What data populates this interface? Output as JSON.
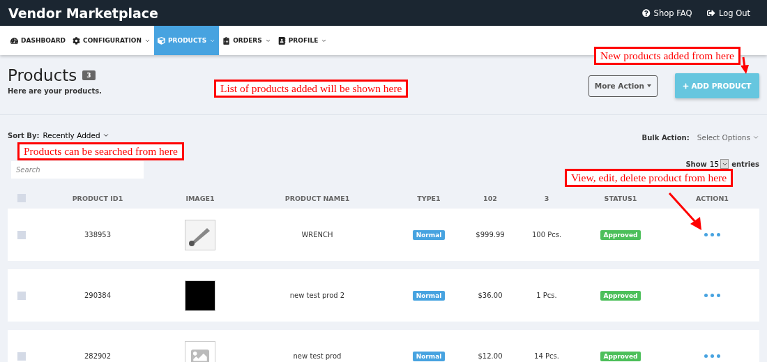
{
  "topbar": {
    "title": "Vendor Marketplace",
    "links": [
      {
        "label": "Shop FAQ",
        "kind": "help"
      },
      {
        "label": "Log Out",
        "kind": "logout"
      }
    ]
  },
  "nav": [
    {
      "label": "DASHBOARD",
      "dropdown": false,
      "selected": false
    },
    {
      "label": "CONFIGURATION",
      "dropdown": true,
      "selected": false
    },
    {
      "label": "PRODUCTS",
      "dropdown": true,
      "selected": true
    },
    {
      "label": "ORDERS",
      "dropdown": true,
      "selected": false
    },
    {
      "label": "PROFILE",
      "dropdown": true,
      "selected": false
    }
  ],
  "header": {
    "title": "Products",
    "count": "3",
    "subtitle": "Here are your products.",
    "more_action": "More Action",
    "add_button": "ADD PRODUCT"
  },
  "toolbar": {
    "sort_label": "Sort By:",
    "sort_value": "Recently Added",
    "bulk_label": "Bulk Action:",
    "bulk_value": "Select Options",
    "search_placeholder": "Search",
    "show_label": "Show",
    "show_value": "15",
    "entries_label": "entries"
  },
  "table": {
    "select_all_checked": false,
    "columns": [
      "PRODUCT ID1",
      "IMAGE1",
      "PRODUCT NAME1",
      "TYPE1",
      "102",
      "3",
      "STATUS1",
      "ACTION1"
    ],
    "rows": [
      {
        "checked": false,
        "id": "338953",
        "kind": "photo",
        "name": "WRENCH",
        "type": "Normal",
        "price": "$999.99",
        "quantity": "100 Pcs.",
        "status": "Approved"
      },
      {
        "checked": false,
        "id": "290384",
        "kind": "photo",
        "name": "new test prod 2",
        "type": "Normal",
        "price": "$36.00",
        "quantity": "1 Pcs.",
        "status": "Approved"
      },
      {
        "checked": false,
        "id": "282902",
        "kind": "placeholder",
        "name": "new test prod",
        "type": "Normal",
        "price": "$12.00",
        "quantity": "14 Pcs.",
        "status": "Approved"
      }
    ]
  },
  "annotations": [
    {
      "text": "New products added from here"
    },
    {
      "text": "List of products added will be shown here"
    },
    {
      "text": "Products can be searched from here"
    },
    {
      "text": "View, edit, delete product from here"
    }
  ]
}
